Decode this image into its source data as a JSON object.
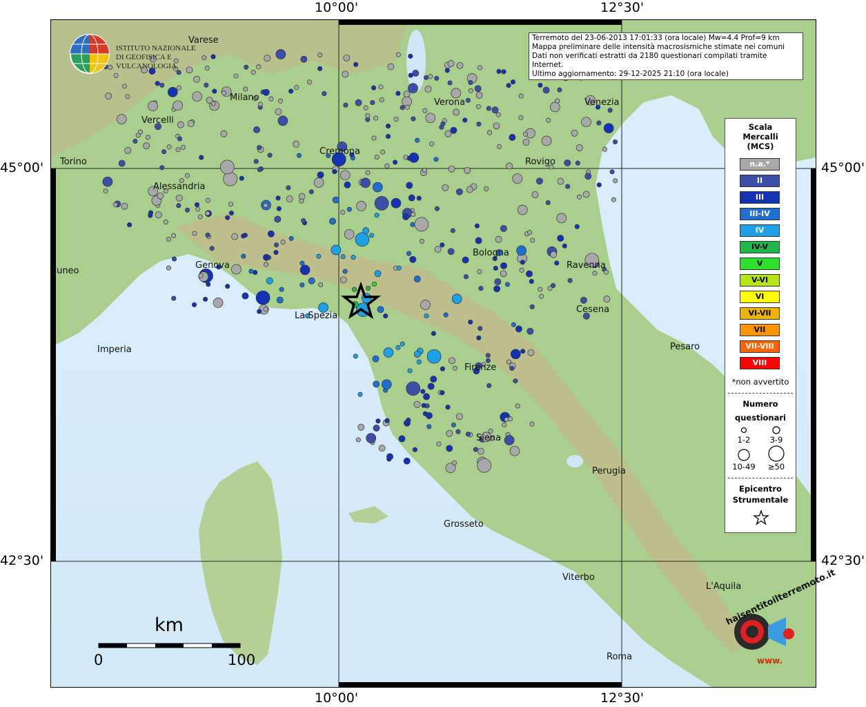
{
  "axes": {
    "top_ticks": [
      "10°00'",
      "12°30'"
    ],
    "bottom_ticks": [
      "10°00'",
      "12°30'"
    ],
    "left_ticks": [
      "45°00'",
      "42°30'"
    ],
    "right_ticks": [
      "45°00'",
      "42°30'"
    ]
  },
  "header": {
    "institute_line1": "ISTITUTO NAZIONALE",
    "institute_line2": "DI GEOFISICA E VULCANOLOGIA"
  },
  "info": {
    "line1": "Terremoto del 23-06-2013 17:01:33 (ora locale) Mw=4.4 Prof=9 km",
    "line2": "Mappa preliminare delle intensità macrosismiche stimate nei comuni",
    "line3": "Dati non verificati estratti da 2180 questionari compilati tramite Internet.",
    "line4": "Ultimo aggiornamento: 29-12-2025 21:10 (ora locale)"
  },
  "cities": [
    {
      "name": "Varese"
    },
    {
      "name": "Milano"
    },
    {
      "name": "Vercelli"
    },
    {
      "name": "Torino"
    },
    {
      "name": "Cremona"
    },
    {
      "name": "Verona"
    },
    {
      "name": "Venezia"
    },
    {
      "name": "Rovigo"
    },
    {
      "name": "Alessandria"
    },
    {
      "name": "Genova"
    },
    {
      "name": "Bologna"
    },
    {
      "name": "Ravenna"
    },
    {
      "name": "Cesena"
    },
    {
      "name": "La Spezia"
    },
    {
      "name": "Cuneo"
    },
    {
      "name": "Imperia"
    },
    {
      "name": "Pesaro"
    },
    {
      "name": "Firenze"
    },
    {
      "name": "Siena"
    },
    {
      "name": "Perugia"
    },
    {
      "name": "Grosseto"
    },
    {
      "name": "Viterbo"
    },
    {
      "name": "L'Aquila"
    },
    {
      "name": "Roma"
    }
  ],
  "legend": {
    "title_lines": [
      "Scala",
      "Mercalli",
      "(MCS)"
    ],
    "levels": [
      {
        "label": "n.a.*",
        "color": "#a8a8a8"
      },
      {
        "label": "II",
        "color": "#3b4fa8"
      },
      {
        "label": "III",
        "color": "#1432b4"
      },
      {
        "label": "III-IV",
        "color": "#1f6fd0"
      },
      {
        "label": "IV",
        "color": "#1ea0e6"
      },
      {
        "label": "IV-V",
        "color": "#1fb84a"
      },
      {
        "label": "V",
        "color": "#2ee02e"
      },
      {
        "label": "V-VI",
        "color": "#b8e614"
      },
      {
        "label": "VI",
        "color": "#ffff00"
      },
      {
        "label": "VI-VII",
        "color": "#f0b400"
      },
      {
        "label": "VII",
        "color": "#ff9600"
      },
      {
        "label": "VII-VIII",
        "color": "#ff6400"
      },
      {
        "label": "VIII",
        "color": "#ff0000"
      }
    ],
    "non_avvertito": "*non avvertito",
    "count_title_lines": [
      "Numero",
      "questionari"
    ],
    "count_classes": [
      "1-2",
      "3-9",
      "10-49",
      "≥50"
    ],
    "epicentro_lines": [
      "Epicentro",
      "Strumentale"
    ]
  },
  "scalebar": {
    "unit": "km",
    "start": "0",
    "end": "100"
  },
  "brand": {
    "ring_text": "haisentitoilterremoto.it",
    "url_text": "www."
  }
}
